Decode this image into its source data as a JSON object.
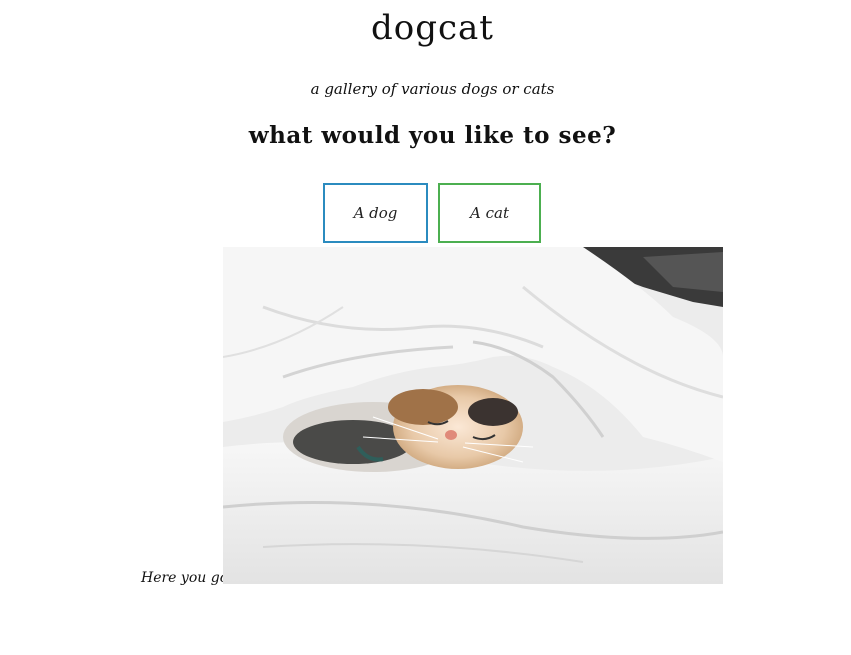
{
  "header": {
    "title": "dogcat",
    "tagline": "a gallery of various dogs or cats",
    "prompt": "what would you like to see?"
  },
  "choices": {
    "dog_label": "A dog",
    "cat_label": "A cat"
  },
  "result": {
    "caption": "Here you go!",
    "image_alt": "cat sleeping under a white duvet"
  },
  "colors": {
    "dog_button_border": "#2b8bbf",
    "cat_button_border": "#4caf50",
    "background": "#ffffff",
    "text": "#111111"
  }
}
